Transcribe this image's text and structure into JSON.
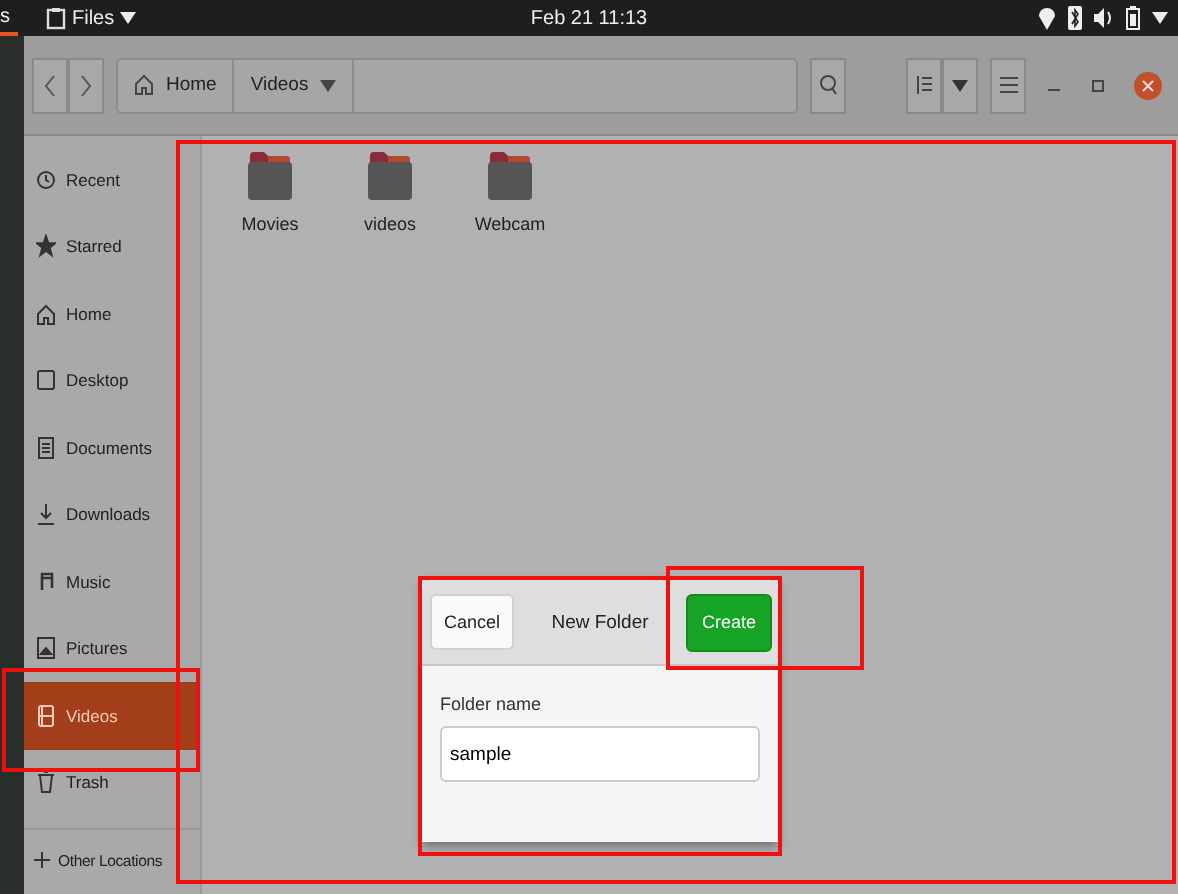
{
  "top_bar": {
    "activities": "s",
    "app_name": "Files",
    "clock": "Feb 21 11:13"
  },
  "path_bar": [
    {
      "label": "Home",
      "kind": "home"
    },
    {
      "label": "Videos",
      "kind": "current"
    }
  ],
  "sidebar": {
    "items": [
      {
        "label": "Recent",
        "kind": "recent",
        "selected": false
      },
      {
        "label": "Starred",
        "kind": "star",
        "selected": false
      },
      {
        "label": "Home",
        "kind": "home",
        "selected": false
      },
      {
        "label": "Desktop",
        "kind": "desktop",
        "selected": false
      },
      {
        "label": "Documents",
        "kind": "document",
        "selected": false
      },
      {
        "label": "Downloads",
        "kind": "download",
        "selected": false
      },
      {
        "label": "Music",
        "kind": "music",
        "selected": false
      },
      {
        "label": "Pictures",
        "kind": "picture",
        "selected": false
      },
      {
        "label": "Videos",
        "kind": "video",
        "selected": true
      },
      {
        "label": "Trash",
        "kind": "trash",
        "selected": false
      }
    ],
    "other_locations": "Other Locations"
  },
  "folders": [
    {
      "name": "Movies"
    },
    {
      "name": "videos"
    },
    {
      "name": "Webcam"
    }
  ],
  "dialog": {
    "title": "New Folder",
    "cancel": "Cancel",
    "create": "Create",
    "field_label": "Folder name",
    "value": "sample"
  }
}
